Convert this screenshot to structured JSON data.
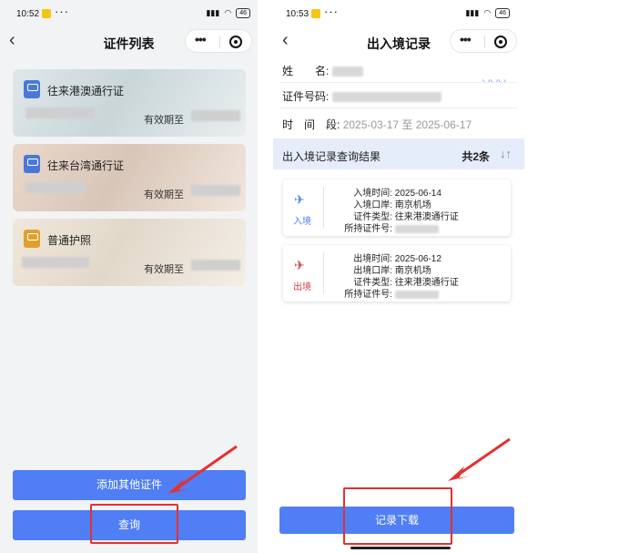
{
  "left": {
    "status": {
      "time": "10:52",
      "battery": "46"
    },
    "nav": {
      "back": "‹",
      "title": "证件列表"
    },
    "cards": [
      {
        "name": "往来港澳通行证",
        "valid_label": "有效期至",
        "icon_color": "#4a78d8"
      },
      {
        "name": "往来台湾通行证",
        "valid_label": "有效期至",
        "icon_color": "#4a78d8"
      },
      {
        "name": "普通护照",
        "valid_label": "有效期至",
        "icon_color": "#e0a030"
      }
    ],
    "buttons": {
      "add": "添加其他证件",
      "query": "查询"
    }
  },
  "right": {
    "status": {
      "time": "10:53",
      "battery": "46"
    },
    "nav": {
      "back": "‹",
      "title": "出入境记录"
    },
    "info": {
      "name_label": "姓　　名:",
      "id_label": "证件号码:",
      "period_label": "时　间　段:",
      "period_value": "2025-03-17 至 2025-06-17"
    },
    "result": {
      "title": "出入境记录查询结果",
      "count": "共2条",
      "sort_icon": "↓↑"
    },
    "records": [
      {
        "type": "入境",
        "lines": [
          {
            "label": "入境时间:",
            "value": "2025-06-14"
          },
          {
            "label": "入境口岸:",
            "value": "南京机场"
          },
          {
            "label": "证件类型:",
            "value": "往来港澳通行证"
          },
          {
            "label": "所持证件号:",
            "value": ""
          }
        ]
      },
      {
        "type": "出境",
        "lines": [
          {
            "label": "出境时间:",
            "value": "2025-06-12"
          },
          {
            "label": "出境口岸:",
            "value": "南京机场"
          },
          {
            "label": "证件类型:",
            "value": "往来港澳通行证"
          },
          {
            "label": "所持证件号:",
            "value": ""
          }
        ]
      }
    ],
    "buttons": {
      "download": "记录下载"
    }
  },
  "colors": {
    "primary": "#4f7ef5",
    "highlight": "#e53030",
    "entry": "#4f7ef5",
    "exit": "#d04040"
  }
}
